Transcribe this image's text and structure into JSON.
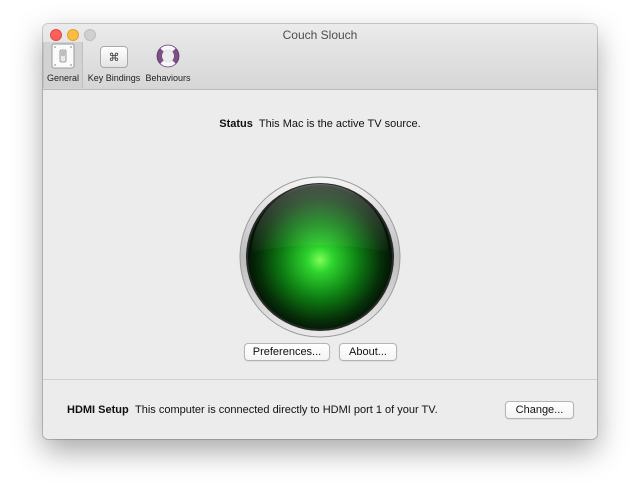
{
  "window": {
    "title": "Couch Slouch"
  },
  "toolbar": {
    "items": [
      {
        "label": "General",
        "icon": "switch-icon",
        "active": true
      },
      {
        "label": "Key Bindings",
        "icon": "command-key-icon",
        "glyph": "⌘"
      },
      {
        "label": "Behaviours",
        "icon": "lifebuoy-icon"
      }
    ]
  },
  "status": {
    "label": "Status",
    "text": "This Mac is the active TV source.",
    "indicator_color": "#2ed32e",
    "indicator": "green-status-light"
  },
  "buttons": {
    "preferences": "Preferences...",
    "about": "About..."
  },
  "hdmi": {
    "title": "HDMI Setup",
    "text": "This computer is connected directly to HDMI port 1 of your TV.",
    "change_button": "Change..."
  }
}
